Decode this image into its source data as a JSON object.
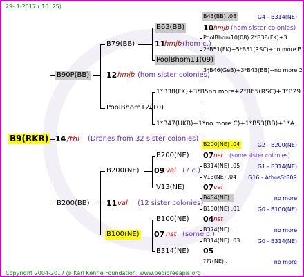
{
  "header_date": "29- 1-2017 ( 16: 25)",
  "footer": "Copyright 2004-2017 @ Karl Kehrle Foundation.   www.pedigreeapis.org",
  "gen0": {
    "name": "B9(RKR)",
    "num": "14",
    "sym": "/thl",
    "note": "(Drones from 32 sister colonies)"
  },
  "gen1": {
    "top": {
      "name": "B90P(BB)",
      "num": "12",
      "sym": "hmjb",
      "note": "(hom sister colonies)"
    },
    "bottom": {
      "name": "B200(BB)",
      "num": "11",
      "sym": "val",
      "note": "(12 sister colonies)"
    }
  },
  "gen2": {
    "a": {
      "name": "B79(BB)",
      "num": "11",
      "sym": "hmjb",
      "note": "(hom c.)"
    },
    "b": {
      "name": "PoolBhom12(10)"
    },
    "c": {
      "name": "B200(NE)",
      "num": "09",
      "sym": "val",
      "note": "(7 c.)"
    },
    "d": {
      "name": "B100(NE)",
      "num": "07",
      "sym": "nst",
      "note": "(some c.)"
    }
  },
  "gen3": {
    "a": {
      "name": "B63(BB)",
      "num": "10",
      "sym": "hmjb",
      "note": "(hom sister colonies)"
    },
    "b": {
      "name": "PoolBhom11(09)"
    },
    "c": {
      "formula": "1*B38(FK)+3*B5no more+2*B65(RSC)+3*B29"
    },
    "d": {
      "formula": "1*B47(UKB)+1*no more C)+1*B53(BB)+1*A"
    },
    "e": {
      "name": "B200(NE)",
      "num": "07",
      "sym": "nst",
      "note": "(some sister colonies)"
    },
    "f": {
      "name": "V13(NE)",
      "num": "07",
      "sym": "val"
    },
    "g": {
      "name": "B100(NE)",
      "num": "04",
      "sym": "nst"
    },
    "h": {
      "name": "B314(NE)",
      "num": "05"
    }
  },
  "gen4": [
    {
      "left": "B43(BB) .08",
      "right": "G4 - B314(NE)",
      "style": "gray"
    },
    {
      "left": "PoolBhom10(08) 2*B38(FK)+3",
      "right": "",
      "style": "none"
    },
    {
      "left": "2*B51(FK)+5*B51(RSC)+no more B36(",
      "right": "",
      "style": "none"
    },
    {
      "left": "3*B46(GeB)+3*B43(BB)+no more 2*B25(A",
      "right": "",
      "style": "none"
    },
    {
      "left": "B200(NE) .04",
      "right": "G2 - B200(NE)",
      "style": "yellow"
    },
    {
      "left": "B314(NE) .05",
      "right": "G1 - B314(NE)",
      "style": "none"
    },
    {
      "left": "V13(NE) .04",
      "right": "G16 - AthosSt80R",
      "style": "none"
    },
    {
      "left": "B434(NE) .",
      "right": "no more",
      "style": "gray"
    },
    {
      "left": "B100(NE) .01",
      "right": "G0 - B100(NE)",
      "style": "none"
    },
    {
      "left": "B374(NE) .",
      "right": "no more",
      "style": "none"
    },
    {
      "left": "B314(NE) .03",
      "right": "G0 - B314(NE)",
      "style": "none"
    },
    {
      "left": "???(NE) .",
      "right": "no more",
      "style": "none"
    }
  ]
}
